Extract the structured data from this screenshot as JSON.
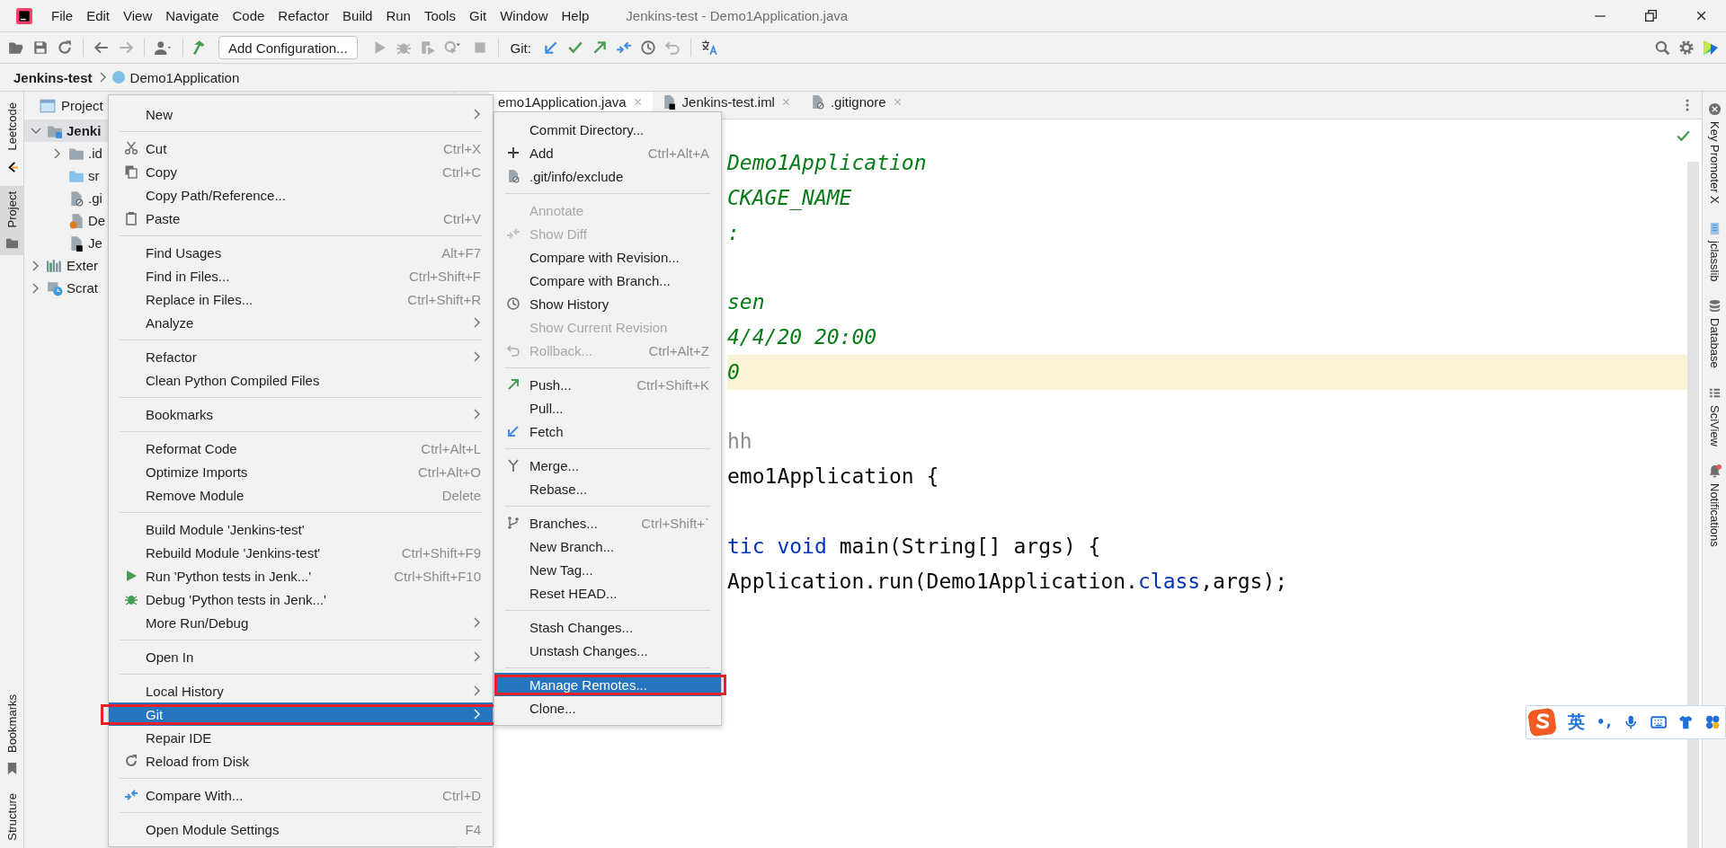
{
  "window": {
    "title": "Jenkins-test - Demo1Application.java"
  },
  "menu_bar": [
    "File",
    "Edit",
    "View",
    "Navigate",
    "Code",
    "Refactor",
    "Build",
    "Run",
    "Tools",
    "Git",
    "Window",
    "Help"
  ],
  "toolbar": {
    "run_config": "Add Configuration...",
    "vcs_label": "Git:"
  },
  "breadcrumb": [
    "Jenkins-test",
    "Demo1Application"
  ],
  "left_tool_strip": {
    "top": [
      {
        "label": "Leetcode",
        "selected": false
      },
      {
        "label": "Project",
        "selected": true
      }
    ],
    "bottom": [
      {
        "label": "Bookmarks",
        "selected": false
      },
      {
        "label": "Structure",
        "selected": false
      }
    ]
  },
  "project_panel": {
    "title": "Project",
    "tree": [
      {
        "label": "Jenki",
        "kind": "module",
        "expanded": true,
        "selected": true,
        "children": [
          {
            "label": ".id",
            "kind": "folder",
            "expanded": false,
            "selected": false
          },
          {
            "label": "sr",
            "kind": "source",
            "selected": false
          },
          {
            "label": ".gi",
            "kind": "ignore",
            "selected": false
          },
          {
            "label": "De",
            "kind": "java",
            "selected": false
          },
          {
            "label": "Je",
            "kind": "iml",
            "selected": false
          }
        ]
      },
      {
        "label": "Exter",
        "kind": "library",
        "expanded": false,
        "selected": false
      },
      {
        "label": "Scrat",
        "kind": "scratch",
        "expanded": false,
        "selected": false
      }
    ]
  },
  "editor": {
    "tabs": [
      {
        "label": "emo1Application.java",
        "selected": true
      },
      {
        "label": "Jenkins-test.iml",
        "kind": "iml",
        "selected": false
      },
      {
        "label": ".gitignore",
        "kind": "ignore",
        "selected": false
      }
    ],
    "blocks": [
      [
        {
          "current": false,
          "segments": [
            {
              "text": "Demo1Application",
              "kind": "comment"
            }
          ]
        },
        {
          "current": false,
          "segments": [
            {
              "text": "CKAGE_NAME",
              "kind": "comment"
            }
          ]
        },
        {
          "current": false,
          "segments": [
            {
              "text": ":",
              "kind": "comment"
            }
          ]
        }
      ],
      [
        {
          "current": false,
          "segments": [
            {
              "text": "sen",
              "kind": "comment"
            }
          ]
        },
        {
          "current": false,
          "segments": [
            {
              "text": "4/4/20 20:00",
              "kind": "comment"
            }
          ]
        },
        {
          "current": true,
          "segments": [
            {
              "text": "0",
              "kind": "comment"
            }
          ]
        }
      ],
      [
        {
          "current": false,
          "segments": [
            {
              "text": "hh",
              "kind": "muted"
            }
          ]
        },
        {
          "current": false,
          "segments": [
            {
              "text": "emo1Application {",
              "kind": "plain"
            }
          ]
        }
      ],
      [
        {
          "current": false,
          "segments": [
            {
              "text": "tic void",
              "kind": "keyword"
            },
            {
              "text": " main(String[] args) {",
              "kind": "plain"
            }
          ]
        },
        {
          "current": false,
          "segments": [
            {
              "text": "Application.run(Demo1Application.",
              "kind": "plain"
            },
            {
              "text": "class",
              "kind": "keyword"
            },
            {
              "text": ",args);",
              "kind": "plain"
            }
          ]
        }
      ]
    ]
  },
  "right_tool_strip": [
    {
      "label": "Key Promoter X",
      "badge": false
    },
    {
      "label": "jclasslib",
      "badge": false
    },
    {
      "label": "Database",
      "badge": false
    },
    {
      "label": "SciView",
      "badge": false
    },
    {
      "label": "Notifications",
      "badge": true
    }
  ],
  "context_menu": {
    "groups": [
      [
        {
          "label": "New",
          "submenu": true,
          "selected": false,
          "marked": false
        }
      ],
      [
        {
          "label": "Cut",
          "shortcut": "Ctrl+X",
          "submenu": false,
          "selected": false,
          "marked": false
        },
        {
          "label": "Copy",
          "shortcut": "Ctrl+C",
          "submenu": false,
          "selected": false,
          "marked": false
        },
        {
          "label": "Copy Path/Reference...",
          "submenu": false,
          "selected": false,
          "marked": false
        },
        {
          "label": "Paste",
          "shortcut": "Ctrl+V",
          "submenu": false,
          "selected": false,
          "marked": false
        }
      ],
      [
        {
          "label": "Find Usages",
          "shortcut": "Alt+F7",
          "submenu": false,
          "selected": false,
          "marked": false
        },
        {
          "label": "Find in Files...",
          "shortcut": "Ctrl+Shift+F",
          "submenu": false,
          "selected": false,
          "marked": false
        },
        {
          "label": "Replace in Files...",
          "shortcut": "Ctrl+Shift+R",
          "submenu": false,
          "selected": false,
          "marked": false
        },
        {
          "label": "Analyze",
          "submenu": true,
          "selected": false,
          "marked": false
        }
      ],
      [
        {
          "label": "Refactor",
          "submenu": true,
          "selected": false,
          "marked": false
        },
        {
          "label": "Clean Python Compiled Files",
          "submenu": false,
          "selected": false,
          "marked": false
        }
      ],
      [
        {
          "label": "Bookmarks",
          "submenu": true,
          "selected": false,
          "marked": false
        }
      ],
      [
        {
          "label": "Reformat Code",
          "shortcut": "Ctrl+Alt+L",
          "submenu": false,
          "selected": false,
          "marked": false
        },
        {
          "label": "Optimize Imports",
          "shortcut": "Ctrl+Alt+O",
          "submenu": false,
          "selected": false,
          "marked": false
        },
        {
          "label": "Remove Module",
          "shortcut": "Delete",
          "submenu": false,
          "selected": false,
          "marked": false
        }
      ],
      [
        {
          "label": "Build Module 'Jenkins-test'",
          "submenu": false,
          "selected": false,
          "marked": false
        },
        {
          "label": "Rebuild Module 'Jenkins-test'",
          "shortcut": "Ctrl+Shift+F9",
          "submenu": false,
          "selected": false,
          "marked": false
        },
        {
          "label": "Run 'Python tests in Jenk...'",
          "shortcut": "Ctrl+Shift+F10",
          "submenu": false,
          "selected": false,
          "marked": false
        },
        {
          "label": "Debug 'Python tests in Jenk...'",
          "submenu": false,
          "selected": false,
          "marked": false
        },
        {
          "label": "More Run/Debug",
          "submenu": true,
          "selected": false,
          "marked": false
        }
      ],
      [
        {
          "label": "Open In",
          "submenu": true,
          "selected": false,
          "marked": false
        }
      ],
      [
        {
          "label": "Local History",
          "submenu": true,
          "selected": false,
          "marked": false
        },
        {
          "label": "Git",
          "submenu": true,
          "selected": true,
          "marked": true
        },
        {
          "label": "Repair IDE",
          "submenu": false,
          "selected": false,
          "marked": false
        },
        {
          "label": "Reload from Disk",
          "submenu": false,
          "selected": false,
          "marked": false
        }
      ],
      [
        {
          "label": "Compare With...",
          "shortcut": "Ctrl+D",
          "submenu": false,
          "selected": false,
          "marked": false
        }
      ],
      [
        {
          "label": "Open Module Settings",
          "shortcut": "F4",
          "submenu": false,
          "selected": false,
          "marked": false
        }
      ]
    ]
  },
  "git_submenu": {
    "groups": [
      [
        {
          "label": "Commit Directory...",
          "disabled": false,
          "selected": false,
          "marked": false
        },
        {
          "label": "Add",
          "shortcut": "Ctrl+Alt+A",
          "disabled": false,
          "selected": false,
          "marked": false
        },
        {
          "label": ".git/info/exclude",
          "disabled": false,
          "selected": false,
          "marked": false
        }
      ],
      [
        {
          "label": "Annotate",
          "disabled": true,
          "selected": false,
          "marked": false
        },
        {
          "label": "Show Diff",
          "disabled": true,
          "selected": false,
          "marked": false
        },
        {
          "label": "Compare with Revision...",
          "disabled": false,
          "selected": false,
          "marked": false
        },
        {
          "label": "Compare with Branch...",
          "disabled": false,
          "selected": false,
          "marked": false
        },
        {
          "label": "Show History",
          "disabled": false,
          "selected": false,
          "marked": false
        },
        {
          "label": "Show Current Revision",
          "disabled": true,
          "selected": false,
          "marked": false
        },
        {
          "label": "Rollback...",
          "shortcut": "Ctrl+Alt+Z",
          "disabled": true,
          "selected": false,
          "marked": false
        }
      ],
      [
        {
          "label": "Push...",
          "shortcut": "Ctrl+Shift+K",
          "disabled": false,
          "selected": false,
          "marked": false
        },
        {
          "label": "Pull...",
          "disabled": false,
          "selected": false,
          "marked": false
        },
        {
          "label": "Fetch",
          "disabled": false,
          "selected": false,
          "marked": false
        }
      ],
      [
        {
          "label": "Merge...",
          "disabled": false,
          "selected": false,
          "marked": false
        },
        {
          "label": "Rebase...",
          "disabled": false,
          "selected": false,
          "marked": false
        }
      ],
      [
        {
          "label": "Branches...",
          "shortcut": "Ctrl+Shift+`",
          "disabled": false,
          "selected": false,
          "marked": false
        },
        {
          "label": "New Branch...",
          "disabled": false,
          "selected": false,
          "marked": false
        },
        {
          "label": "New Tag...",
          "disabled": false,
          "selected": false,
          "marked": false
        },
        {
          "label": "Reset HEAD...",
          "disabled": false,
          "selected": false,
          "marked": false
        }
      ],
      [
        {
          "label": "Stash Changes...",
          "disabled": false,
          "selected": false,
          "marked": false
        },
        {
          "label": "Unstash Changes...",
          "disabled": false,
          "selected": false,
          "marked": false
        }
      ],
      [
        {
          "label": "Manage Remotes...",
          "disabled": false,
          "selected": true,
          "marked": true
        },
        {
          "label": "Clone...",
          "disabled": false,
          "selected": false,
          "marked": false
        }
      ]
    ]
  },
  "input_method": {
    "mode": "英",
    "punctuation": "•,"
  }
}
